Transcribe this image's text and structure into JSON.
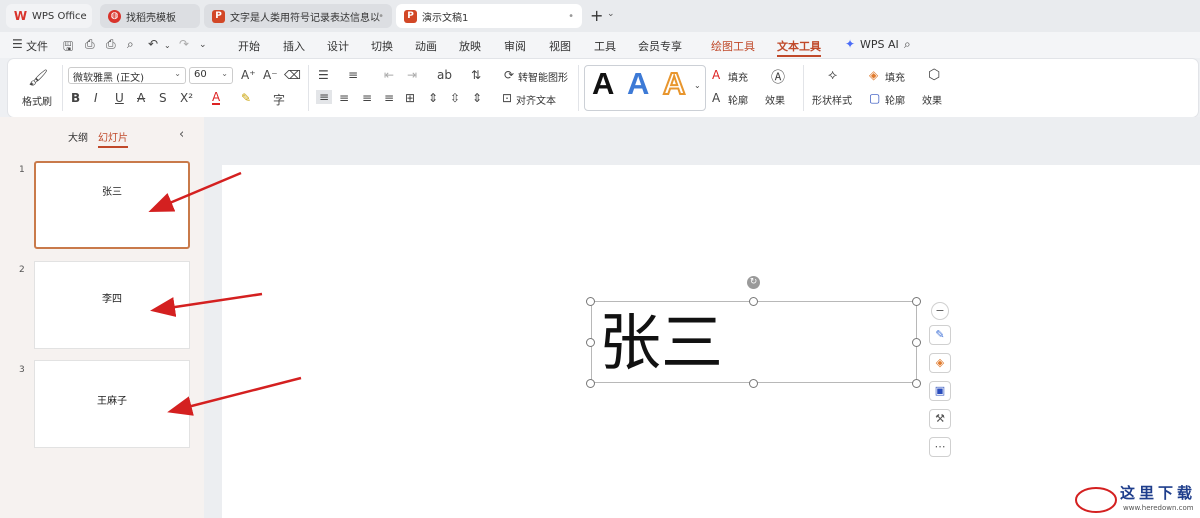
{
  "tabs": [
    {
      "label": "WPS Office",
      "icon": "wps-logo-icon"
    },
    {
      "label": "找稻壳模板",
      "icon": "template-icon"
    },
    {
      "label": "文字是人类用符号记录表达信息以",
      "icon": "ppt-icon"
    },
    {
      "label": "演示文稿1",
      "icon": "ppt-icon"
    }
  ],
  "tabbar": {
    "add": "+",
    "more": "⌄",
    "close": "•"
  },
  "menu": {
    "file": "文件",
    "items": [
      "开始",
      "插入",
      "设计",
      "切换",
      "动画",
      "放映",
      "审阅",
      "视图",
      "工具",
      "会员专享"
    ],
    "tool_tabs": [
      "绘图工具",
      "文本工具"
    ],
    "ai": "WPS AI"
  },
  "ribbon": {
    "format_painter": "格式刷",
    "font_name": "微软雅黑 (正文)",
    "font_size": "60",
    "smart_shape": "转智能图形",
    "align_text": "对齐文本",
    "text_fill": "填充",
    "text_outline": "轮廓",
    "text_effect": "效果",
    "shape_style": "形状样式",
    "shape_fill": "填充",
    "shape_outline": "轮廓",
    "shape_effect": "效果",
    "style_letter": "A"
  },
  "leftpanel": {
    "tab_outline": "大纲",
    "tab_slides": "幻灯片",
    "slides": [
      {
        "num": "1",
        "text": "张三"
      },
      {
        "num": "2",
        "text": "李四"
      },
      {
        "num": "3",
        "text": "王麻子"
      }
    ]
  },
  "slide": {
    "textbox_text": "张三"
  },
  "watermark": {
    "cn": "这里下载",
    "en": "www.heredown.com"
  },
  "colors": {
    "accent": "#c0492a",
    "arrow": "#d42020",
    "wps_red": "#d9332b"
  }
}
